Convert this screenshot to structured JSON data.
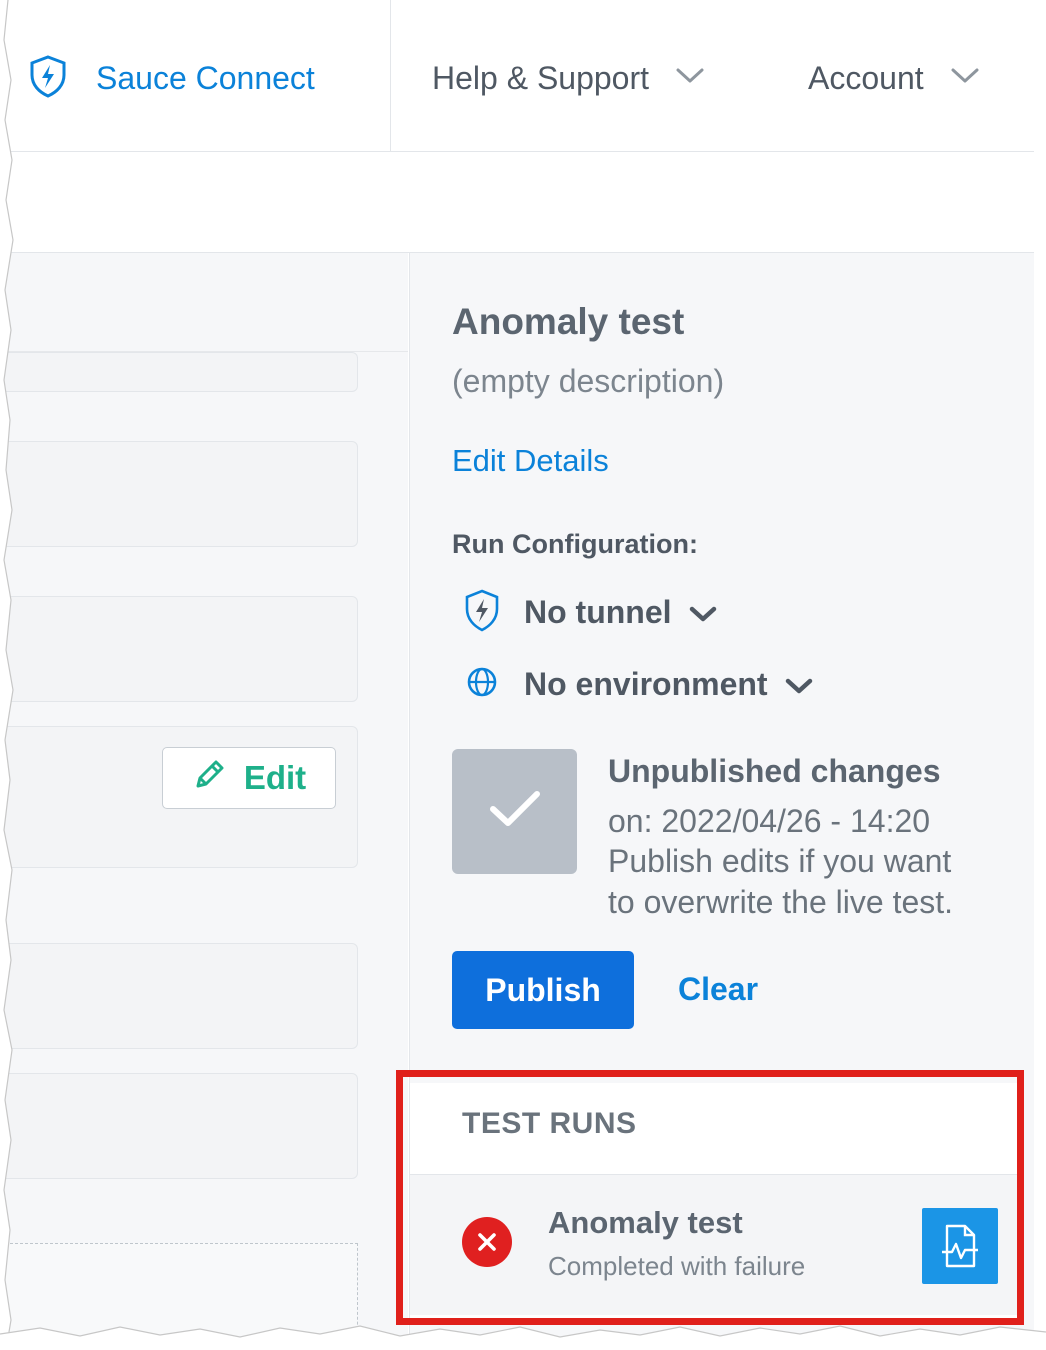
{
  "nav": {
    "sauce_connect": "Sauce Connect",
    "help_support": "Help & Support",
    "account": "Account",
    "icons": {
      "sauce_connect": "shield-bolt-icon",
      "dropdown": "chevron-down-icon"
    }
  },
  "left": {
    "edit_button": "Edit",
    "edit_icon": "pencil-icon",
    "accent_color": "#1eb08a"
  },
  "details": {
    "title": "Anomaly test",
    "description": "(empty description)",
    "edit_details": "Edit Details",
    "run_configuration_label": "Run Configuration:",
    "tunnel": {
      "label": "No tunnel",
      "icon": "shield-bolt-icon"
    },
    "environment": {
      "label": "No environment",
      "icon": "globe-icon"
    }
  },
  "unpublished": {
    "title": "Unpublished changes",
    "line1": "on: 2022/04/26 - 14:20",
    "line2": "Publish edits if you want",
    "line3": "to overwrite the live test.",
    "icon": "checkmark-icon"
  },
  "actions": {
    "publish": "Publish",
    "clear": "Clear",
    "primary_color": "#0e6fdc"
  },
  "test_runs": {
    "title": "TEST RUNS",
    "runs": [
      {
        "name": "Anomaly test",
        "status": "Completed with failure",
        "status_icon": "error-x-icon",
        "report_icon": "report-file-icon"
      }
    ],
    "highlight_color": "#e0201b"
  }
}
